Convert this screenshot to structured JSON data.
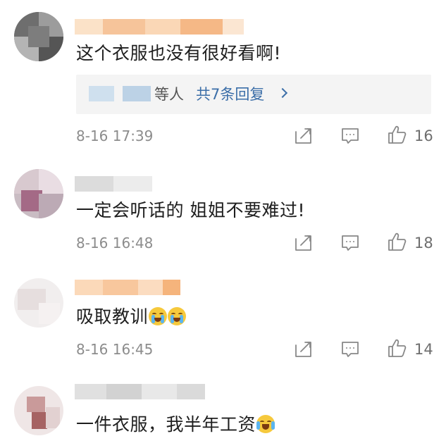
{
  "comments": [
    {
      "text": "这个衣服也没有很好看啊!",
      "reply": {
        "others": "等人",
        "link": "共7条回复"
      },
      "time": "8-16 17:39",
      "likes": "16"
    },
    {
      "text": "一定会听话的 姐姐不要难过!",
      "time": "8-16 16:48",
      "likes": "18"
    },
    {
      "text": "吸取教训",
      "emoji": "crying-face-emoji",
      "emoji_count": 2,
      "time": "8-16 16:45",
      "likes": "14"
    },
    {
      "text": "一件衣服，我半年工资",
      "emoji": "laughing-tears-emoji",
      "emoji_count": 1
    }
  ],
  "icons": [
    "share-icon",
    "comment-icon",
    "like-icon"
  ],
  "colors": {
    "link": "#3b6ea8",
    "meta": "#8c8c8c",
    "reply_bg": "#f4f4f4",
    "blur_orange": "#f7c89a"
  }
}
